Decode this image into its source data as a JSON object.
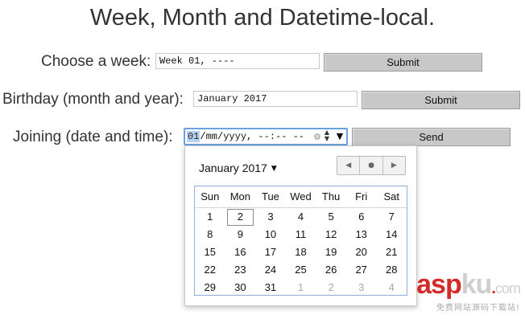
{
  "page": {
    "title": "Week, Month and Datetime-local."
  },
  "week_row": {
    "label": "Choose a week:",
    "value": "Week 01, ----",
    "button": "Submit"
  },
  "month_row": {
    "label": "Birthday (month and year):",
    "value": "January 2017",
    "button": "Submit"
  },
  "datetime_row": {
    "label": "Joining (date and time):",
    "value_highlight": "01",
    "value_rest": "/mm/yyyy, --:-- --",
    "clear_icon": "clear-icon",
    "spinner_icon": "spinner-icon",
    "dropdown_glyph": "▼",
    "button": "Send"
  },
  "picker": {
    "month_label": "January 2017",
    "month_caret": "▼",
    "nav_prev": "◀",
    "nav_today": "●",
    "nav_next": "▶",
    "weekdays": [
      "Sun",
      "Mon",
      "Tue",
      "Wed",
      "Thu",
      "Fri",
      "Sat"
    ],
    "weeks": [
      [
        "1",
        "2",
        "3",
        "4",
        "5",
        "6",
        "7"
      ],
      [
        "8",
        "9",
        "10",
        "11",
        "12",
        "13",
        "14"
      ],
      [
        "15",
        "16",
        "17",
        "18",
        "19",
        "20",
        "21"
      ],
      [
        "22",
        "23",
        "24",
        "25",
        "26",
        "27",
        "28"
      ],
      [
        "29",
        "30",
        "31",
        "1",
        "2",
        "3",
        "4"
      ]
    ],
    "selected_day": "2"
  },
  "watermark": {
    "brand_red": "asp",
    "brand_gray": "ku",
    "dot": ".",
    "tld": "com",
    "subtitle": "免费网站源码下载站!"
  },
  "colors": {
    "focus_border": "#6aa1de",
    "highlight": "#b7d3f3",
    "button_bg": "#c8c8c8",
    "watermark_red": "#d42a2a"
  }
}
